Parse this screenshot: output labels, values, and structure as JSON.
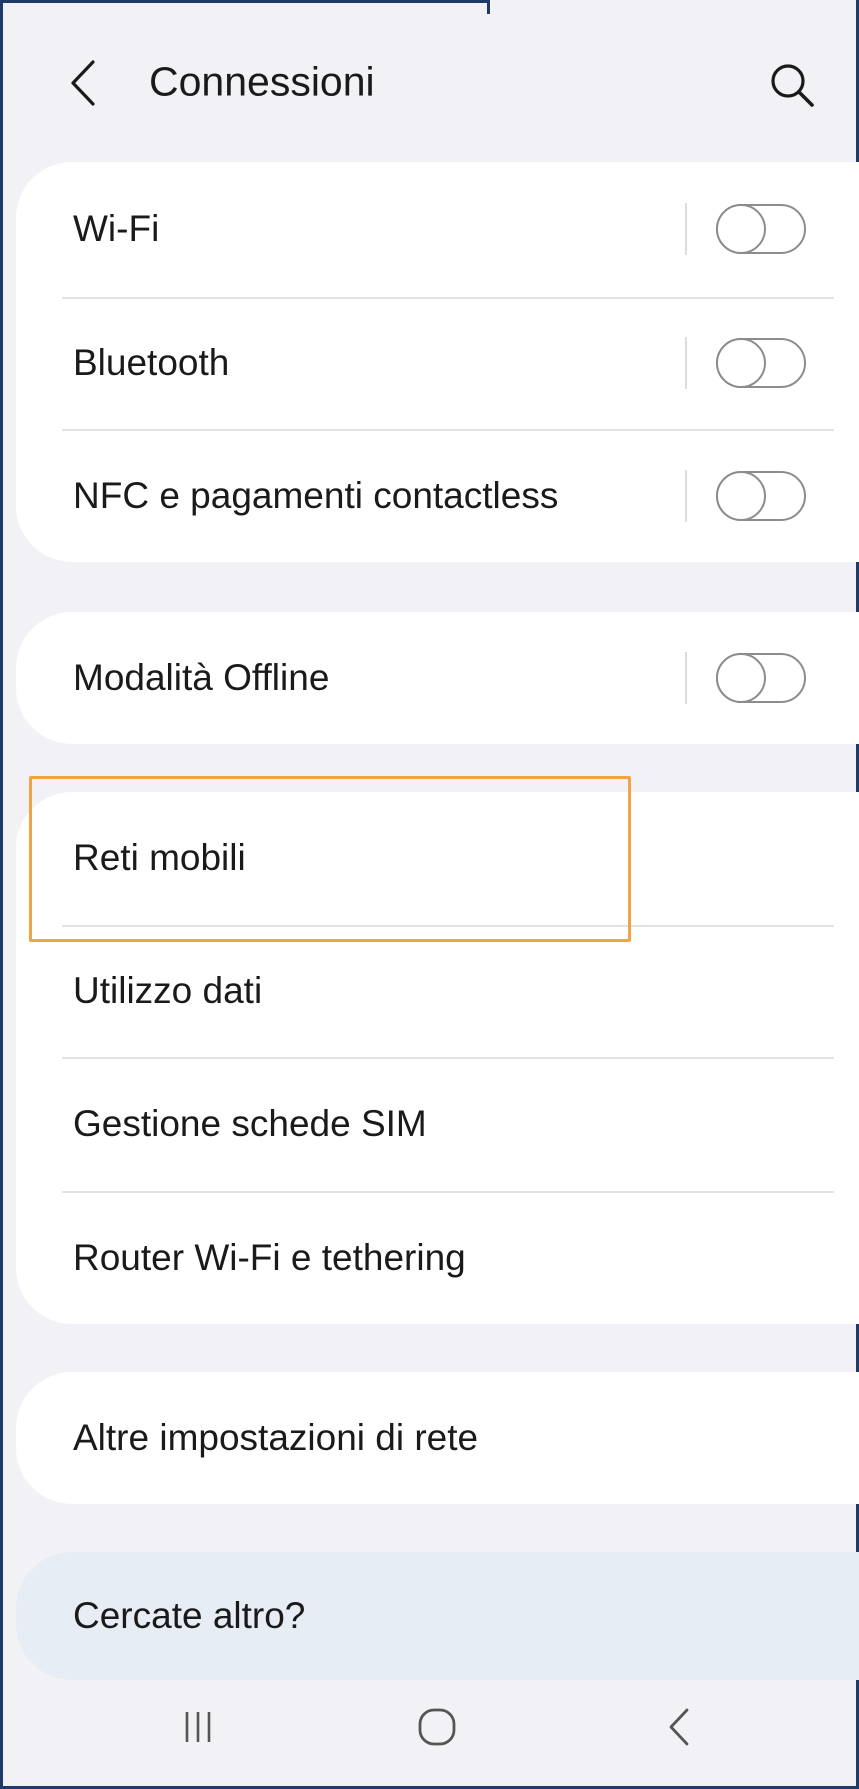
{
  "header": {
    "title": "Connessioni",
    "back_icon": "chevron-left-icon",
    "search_icon": "search-icon"
  },
  "groups": [
    {
      "items": [
        {
          "label": "Wi-Fi",
          "toggle": false
        },
        {
          "label": "Bluetooth",
          "toggle": false
        },
        {
          "label": "NFC e pagamenti contactless",
          "toggle": false
        }
      ]
    },
    {
      "items": [
        {
          "label": "Modalità Offline",
          "toggle": false
        }
      ]
    },
    {
      "items": [
        {
          "label": "Reti mobili",
          "highlighted": true
        },
        {
          "label": "Utilizzo dati"
        },
        {
          "label": "Gestione schede SIM"
        },
        {
          "label": "Router Wi-Fi e tethering"
        }
      ]
    },
    {
      "items": [
        {
          "label": "Altre impostazioni di rete"
        }
      ]
    }
  ],
  "suggestion": {
    "label": "Cercate altro?"
  },
  "navbar": {
    "recents_icon": "recents-icon",
    "home_icon": "home-icon",
    "back_icon": "back-icon"
  },
  "colors": {
    "background": "#f2f2f6",
    "card": "#ffffff",
    "suggestion_card": "#e6edf5",
    "highlight": "#f0a347",
    "frame_border": "#1f3a66",
    "toggle_off": "#8c8c8c"
  }
}
